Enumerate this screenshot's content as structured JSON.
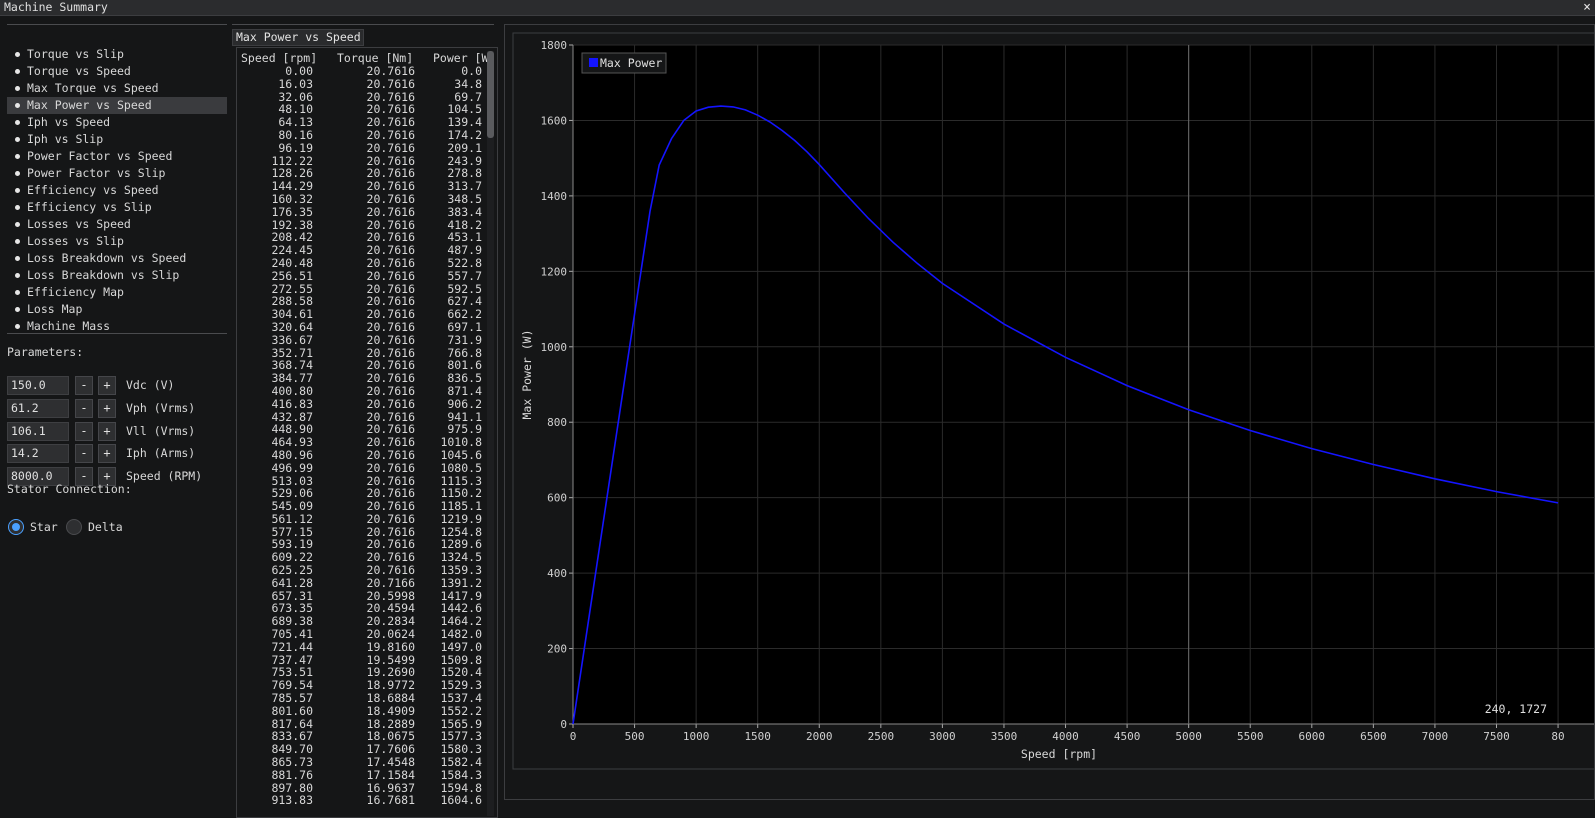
{
  "window": {
    "title": "Machine Summary",
    "close_glyph": "×"
  },
  "plot_list": [
    "Torque vs Slip",
    "Torque vs Speed",
    "Max Torque vs Speed",
    "Max Power vs Speed",
    "Iph vs Speed",
    "Iph vs Slip",
    "Power Factor vs Speed",
    "Power Factor vs Slip",
    "Efficiency vs Speed",
    "Efficiency vs Slip",
    "Losses vs Speed",
    "Losses vs Slip",
    "Loss Breakdown vs Speed",
    "Loss Breakdown vs Slip",
    "Efficiency Map",
    "Loss Map",
    "Machine Mass"
  ],
  "selected_plot": 3,
  "parameters_label": "Parameters:",
  "parameters": [
    {
      "value": "150.0",
      "label": "Vdc (V)"
    },
    {
      "value": "61.2",
      "label": "Vph (Vrms)"
    },
    {
      "value": "106.1",
      "label": "Vll (Vrms)"
    },
    {
      "value": "14.2",
      "label": "Iph (Arms)"
    },
    {
      "value": "8000.0",
      "label": "Speed (RPM)"
    }
  ],
  "stepper": {
    "minus": "-",
    "plus": "+"
  },
  "stator_label": "Stator Connection:",
  "stator_options": [
    "Star",
    "Delta"
  ],
  "stator_selected": "Star",
  "table": {
    "tab_label": "Max Power vs Speed",
    "headers": [
      "Speed [rpm]",
      "Torque [Nm]",
      "Power [W]"
    ],
    "rows": [
      [
        "0.00",
        "20.7616",
        "0.0"
      ],
      [
        "16.03",
        "20.7616",
        "34.8"
      ],
      [
        "32.06",
        "20.7616",
        "69.7"
      ],
      [
        "48.10",
        "20.7616",
        "104.5"
      ],
      [
        "64.13",
        "20.7616",
        "139.4"
      ],
      [
        "80.16",
        "20.7616",
        "174.2"
      ],
      [
        "96.19",
        "20.7616",
        "209.1"
      ],
      [
        "112.22",
        "20.7616",
        "243.9"
      ],
      [
        "128.26",
        "20.7616",
        "278.8"
      ],
      [
        "144.29",
        "20.7616",
        "313.7"
      ],
      [
        "160.32",
        "20.7616",
        "348.5"
      ],
      [
        "176.35",
        "20.7616",
        "383.4"
      ],
      [
        "192.38",
        "20.7616",
        "418.2"
      ],
      [
        "208.42",
        "20.7616",
        "453.1"
      ],
      [
        "224.45",
        "20.7616",
        "487.9"
      ],
      [
        "240.48",
        "20.7616",
        "522.8"
      ],
      [
        "256.51",
        "20.7616",
        "557.7"
      ],
      [
        "272.55",
        "20.7616",
        "592.5"
      ],
      [
        "288.58",
        "20.7616",
        "627.4"
      ],
      [
        "304.61",
        "20.7616",
        "662.2"
      ],
      [
        "320.64",
        "20.7616",
        "697.1"
      ],
      [
        "336.67",
        "20.7616",
        "731.9"
      ],
      [
        "352.71",
        "20.7616",
        "766.8"
      ],
      [
        "368.74",
        "20.7616",
        "801.6"
      ],
      [
        "384.77",
        "20.7616",
        "836.5"
      ],
      [
        "400.80",
        "20.7616",
        "871.4"
      ],
      [
        "416.83",
        "20.7616",
        "906.2"
      ],
      [
        "432.87",
        "20.7616",
        "941.1"
      ],
      [
        "448.90",
        "20.7616",
        "975.9"
      ],
      [
        "464.93",
        "20.7616",
        "1010.8"
      ],
      [
        "480.96",
        "20.7616",
        "1045.6"
      ],
      [
        "496.99",
        "20.7616",
        "1080.5"
      ],
      [
        "513.03",
        "20.7616",
        "1115.3"
      ],
      [
        "529.06",
        "20.7616",
        "1150.2"
      ],
      [
        "545.09",
        "20.7616",
        "1185.1"
      ],
      [
        "561.12",
        "20.7616",
        "1219.9"
      ],
      [
        "577.15",
        "20.7616",
        "1254.8"
      ],
      [
        "593.19",
        "20.7616",
        "1289.6"
      ],
      [
        "609.22",
        "20.7616",
        "1324.5"
      ],
      [
        "625.25",
        "20.7616",
        "1359.3"
      ],
      [
        "641.28",
        "20.7166",
        "1391.2"
      ],
      [
        "657.31",
        "20.5998",
        "1417.9"
      ],
      [
        "673.35",
        "20.4594",
        "1442.6"
      ],
      [
        "689.38",
        "20.2834",
        "1464.2"
      ],
      [
        "705.41",
        "20.0624",
        "1482.0"
      ],
      [
        "721.44",
        "19.8160",
        "1497.0"
      ],
      [
        "737.47",
        "19.5499",
        "1509.8"
      ],
      [
        "753.51",
        "19.2690",
        "1520.4"
      ],
      [
        "769.54",
        "18.9772",
        "1529.3"
      ],
      [
        "785.57",
        "18.6884",
        "1537.4"
      ],
      [
        "801.60",
        "18.4909",
        "1552.2"
      ],
      [
        "817.64",
        "18.2889",
        "1565.9"
      ],
      [
        "833.67",
        "18.0675",
        "1577.3"
      ],
      [
        "849.70",
        "17.7606",
        "1580.3"
      ],
      [
        "865.73",
        "17.4548",
        "1582.4"
      ],
      [
        "881.76",
        "17.1584",
        "1584.3"
      ],
      [
        "897.80",
        "16.9637",
        "1594.8"
      ],
      [
        "913.83",
        "16.7681",
        "1604.6"
      ]
    ]
  },
  "chart_data": {
    "type": "line",
    "title": "",
    "xlabel": "Speed [rpm]",
    "ylabel": "Max Power (W)",
    "xlim": [
      0,
      8000
    ],
    "ylim": [
      0,
      1800
    ],
    "x_ticks": [
      "0",
      "500",
      "1000",
      "1500",
      "2000",
      "2500",
      "3000",
      "3500",
      "4000",
      "4500",
      "5000",
      "5500",
      "6000",
      "6500",
      "7000",
      "7500",
      "80"
    ],
    "y_ticks": [
      "0",
      "200",
      "400",
      "600",
      "800",
      "1000",
      "1200",
      "1400",
      "1600",
      "1800"
    ],
    "grid": true,
    "legend_position": "top-left",
    "cursor_readout": "240, 1727",
    "series": [
      {
        "name": "Max Power",
        "color": "#1414ff",
        "x": [
          0,
          200,
          400,
          625,
          700,
          800,
          900,
          1000,
          1100,
          1200,
          1300,
          1400,
          1500,
          1600,
          1700,
          1800,
          1900,
          2000,
          2200,
          2400,
          2600,
          2800,
          3000,
          3500,
          4000,
          4500,
          5000,
          5500,
          6000,
          6500,
          7000,
          7500,
          8000
        ],
        "y": [
          0,
          435,
          871,
          1359,
          1482,
          1552,
          1600,
          1625,
          1635,
          1638,
          1636,
          1628,
          1614,
          1596,
          1573,
          1547,
          1517,
          1483,
          1410,
          1340,
          1277,
          1220,
          1168,
          1060,
          972,
          897,
          833,
          778,
          730,
          688,
          650,
          616,
          586
        ]
      }
    ]
  }
}
